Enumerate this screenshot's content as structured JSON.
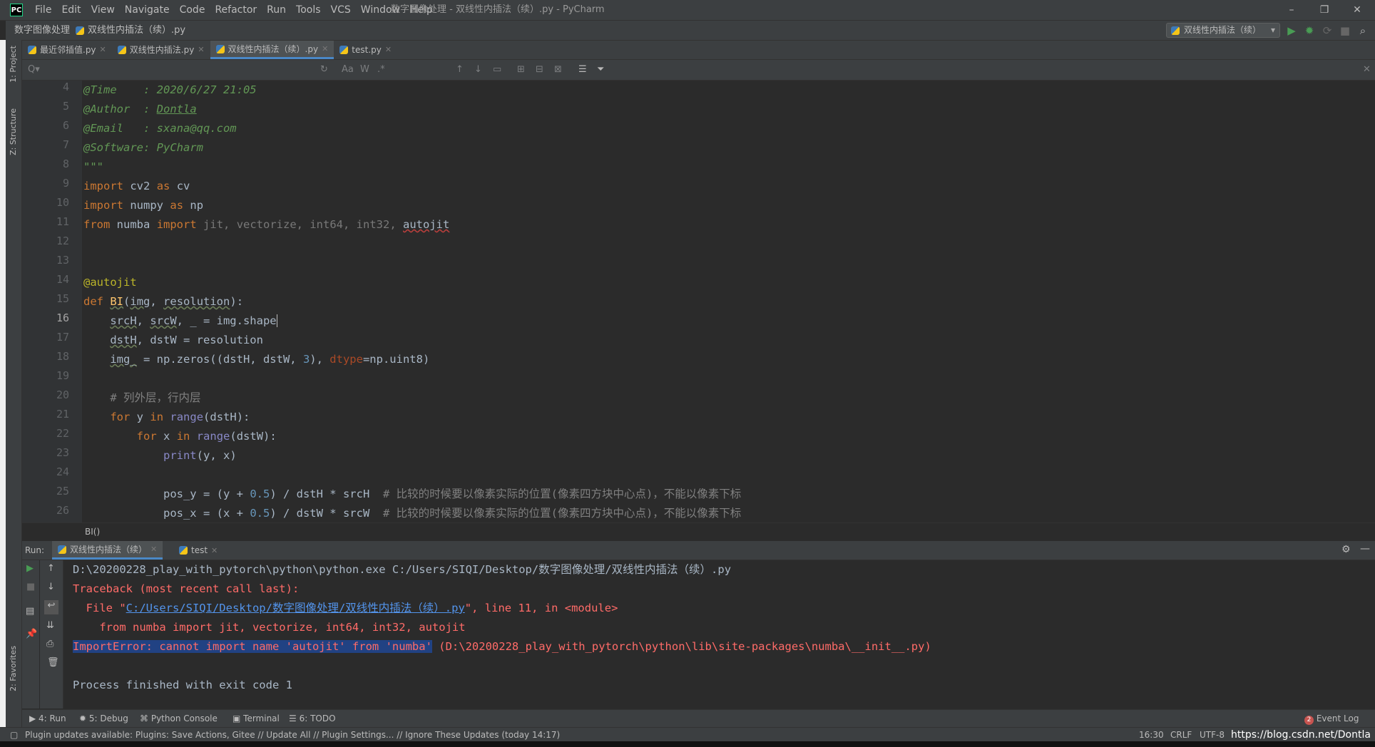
{
  "app": {
    "window_title": "数字图像处理 - 双线性内插法（续）.py - PyCharm",
    "logo": "PC"
  },
  "menu": [
    "File",
    "Edit",
    "View",
    "Navigate",
    "Code",
    "Refactor",
    "Run",
    "Tools",
    "VCS",
    "Window",
    "Help"
  ],
  "navbar": {
    "project": "数字图像处理",
    "file": "双线性内插法（续）.py",
    "run_config": "双线性内插法（续）"
  },
  "left_tools": {
    "project": "1: Project",
    "structure": "Z: Structure",
    "favorites": "2: Favorites"
  },
  "tabs": [
    {
      "label": "最近邻插值.py"
    },
    {
      "label": "双线性内插法.py"
    },
    {
      "label": "双线性内插法（续）.py"
    },
    {
      "label": "test.py"
    }
  ],
  "findbar": {
    "placeholder": "Q▾",
    "match_case": "Aa",
    "words": "W",
    "regex": ".*"
  },
  "editor": {
    "line_numbers": [
      "4",
      "5",
      "6",
      "7",
      "8",
      "9",
      "10",
      "11",
      "12",
      "13",
      "14",
      "15",
      "16",
      "17",
      "18",
      "19",
      "20",
      "21",
      "22",
      "23",
      "24",
      "25",
      "26"
    ],
    "breadcrumb": "BI()",
    "doc_time_key": "@Time    : ",
    "doc_time_val": "2020/6/27 21:05",
    "doc_author_key": "@Author  : ",
    "doc_author_val": "Dontla",
    "doc_email_key": "@Email   : ",
    "doc_email_val": "sxana@qq.com",
    "doc_software": "@Software: PyCharm",
    "doc_close": "\"\"\"",
    "kw_import": "import",
    "kw_as": "as",
    "kw_from": "from",
    "kw_def": "def",
    "kw_for": "for",
    "kw_in": "in",
    "mod_cv2": "cv2",
    "alias_cv": "cv",
    "mod_numpy": "numpy",
    "alias_np": "np",
    "mod_numba": "numba",
    "imp_jit": "jit, vectorize, int64, int32, ",
    "imp_autojit": "autojit",
    "decorator": "@autojit",
    "fn_name": "BI",
    "line15_rest1": "(",
    "param_img": "img",
    "line15_comma": ", ",
    "param_res": "resolution",
    "line15_end": "):",
    "l16_a": "srcH",
    "l16_b": ", ",
    "l16_c": "srcW",
    "l16_d": ", _ = img.shape",
    "l17_a": "dstH",
    "l17_b": ", dstW = resolution",
    "l18_a": "img_",
    "l18_b": " = np.zeros((dstH, dstW, ",
    "l18_num": "3",
    "l18_c": "), ",
    "l18_kw": "dtype",
    "l18_d": "=np.uint8)",
    "l20_comment": "# 列外层，行内层",
    "range": "range",
    "l21_var": "y",
    "l21_arg": "(dstH):",
    "l22_var": "x",
    "l22_arg": "(dstW):",
    "print": "print",
    "l23_args": "(y, x)",
    "l25_a": "pos_y = (y + ",
    "l25_num": "0.5",
    "l25_b": ") / dstH * srcH  ",
    "l25_comment": "# 比较的时候要以像素实际的位置(像素四方块中心点)，不能以像素下标",
    "l26_a": "pos_x = (x + ",
    "l26_num": "0.5",
    "l26_b": ") / dstW * srcW  ",
    "l26_comment": "# 比较的时候要以像素实际的位置(像素四方块中心点)，不能以像素下标"
  },
  "run_panel": {
    "label": "Run:",
    "tabs": [
      "双线性内插法（续）",
      "test"
    ],
    "cmd": "D:\\20200228_play_with_pytorch\\python\\python.exe C:/Users/SIQI/Desktop/数字图像处理/双线性内插法（续）.py",
    "traceback": "Traceback (most recent call last):",
    "file_prefix": "  File \"",
    "file_link": "C:/Users/SIQI/Desktop/数字图像处理/双线性内插法（续）.py",
    "file_suffix": "\", line 11, in <module>",
    "code_line": "    from numba import jit, vectorize, int64, int32, autojit",
    "error_selected": "ImportError: cannot import name 'autojit' from 'numba'",
    "error_rest": " (D:\\20200228_play_with_pytorch\\python\\lib\\site-packages\\numba\\__init__.py)",
    "exit": "Process finished with exit code 1"
  },
  "bottom_tools": {
    "run": "4: Run",
    "debug": "5: Debug",
    "python_console": "Python Console",
    "terminal": "Terminal",
    "todo": "6: TODO",
    "event_log_count": "2",
    "event_log": "Event Log"
  },
  "status": {
    "message": "Plugin updates available: Plugins: Save Actions, Gitee // Update All // Plugin Settings... // Ignore These Updates (today 14:17)",
    "position": "16:30",
    "line_sep": "CRLF",
    "encoding": "UTF-8",
    "watermark": "https://blog.csdn.net/Dontla"
  },
  "colors": {
    "editor_bg": "#2b2b2b",
    "keyword": "#cc7832",
    "docstring": "#629755",
    "error": "#ff6b68",
    "selection": "#214283"
  }
}
